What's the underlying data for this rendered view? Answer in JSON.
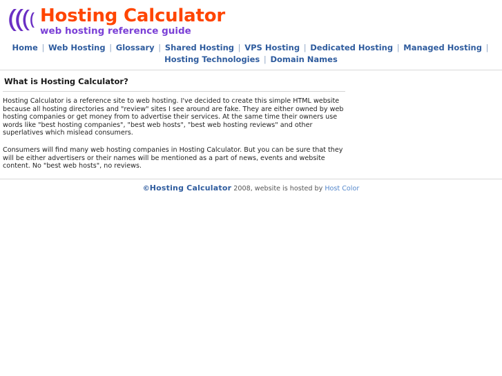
{
  "site": {
    "logo_icon": "sound-wave-arcs-icon",
    "title": "Hosting Calculator",
    "tagline": "web hosting reference guide",
    "brand_color": "#FF4500",
    "tagline_color": "#7A3FD6",
    "link_color": "#2F5C9E"
  },
  "nav": {
    "separator": "|",
    "items": [
      {
        "label": "Home"
      },
      {
        "label": "Web Hosting"
      },
      {
        "label": "Glossary"
      },
      {
        "label": "Shared Hosting"
      },
      {
        "label": "VPS Hosting"
      },
      {
        "label": "Dedicated Hosting"
      },
      {
        "label": "Managed Hosting"
      },
      {
        "label": "Hosting Technologies"
      },
      {
        "label": "Domain Names"
      }
    ]
  },
  "main": {
    "heading": "What is Hosting Calculator?",
    "paragraphs": [
      "Hosting Calculator is a reference site to web hosting. I've decided to create this simple HTML website because all hosting directories and \"review\" sites I see around are fake. They are either owned by web hosting companies or get money from to advertise their services. At the same time their owners use words like \"best hosting companies\", \"best web hosts\", \"best web hosting reviews\" and other superlatives which mislead consumers.",
      "Consumers will find many web hosting companies in Hosting Calculator. But you can be sure that they will be either advertisers or their names will be mentioned as a part of news, events and website content. No \"best web hosts\", no reviews."
    ]
  },
  "footer": {
    "copyright_symbol": "©",
    "brand": "Hosting Calculator",
    "year_text": "2008, website is hosted by",
    "host_link": "Host Color"
  }
}
